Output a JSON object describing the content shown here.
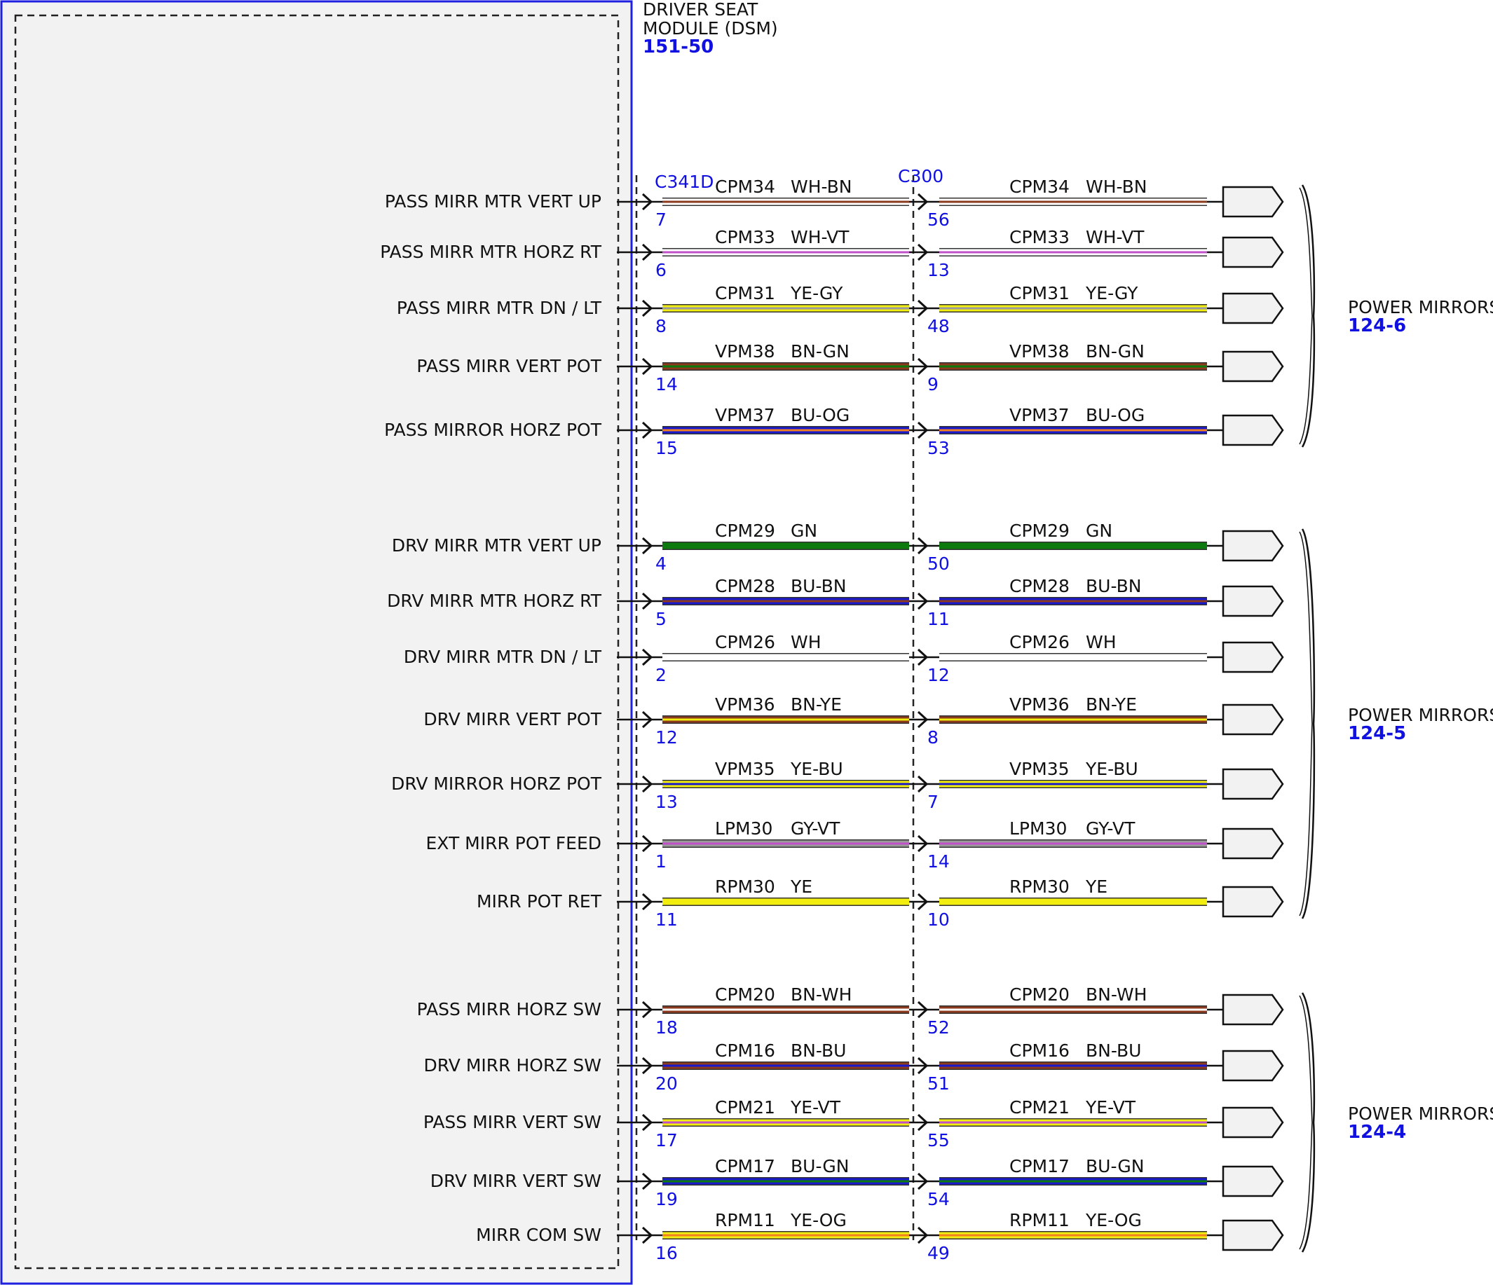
{
  "module": {
    "title_line1": "DRIVER SEAT",
    "title_line2": "MODULE (DSM)",
    "ref": "151-50"
  },
  "connectors": {
    "left": "C341D",
    "right": "C300"
  },
  "colors": {
    "WH": "#ffffff",
    "BN": "#8b3a1e",
    "VT": "#c050c8",
    "YE": "#f2ee10",
    "GY": "#9a9a9a",
    "GN": "#0c7a0c",
    "BU": "#1818cc",
    "OG": "#f08020",
    "module_border": "#2020e0",
    "module_fill": "#f2f2f2",
    "pin_text": "#1010e0"
  },
  "circuits": [
    {
      "label": "PASS MIRR MTR VERT UP",
      "circuit": "CPM34",
      "color": "WH-BN",
      "pin_a": "7",
      "pin_b": "56"
    },
    {
      "label": "PASS MIRR MTR HORZ RT",
      "circuit": "CPM33",
      "color": "WH-VT",
      "pin_a": "6",
      "pin_b": "13"
    },
    {
      "label": "PASS MIRR MTR DN / LT",
      "circuit": "CPM31",
      "color": "YE-GY",
      "pin_a": "8",
      "pin_b": "48"
    },
    {
      "label": "PASS MIRR VERT POT",
      "circuit": "VPM38",
      "color": "BN-GN",
      "pin_a": "14",
      "pin_b": "9"
    },
    {
      "label": "PASS MIRROR HORZ POT",
      "circuit": "VPM37",
      "color": "BU-OG",
      "pin_a": "15",
      "pin_b": "53"
    },
    {
      "label": "DRV MIRR MTR VERT UP",
      "circuit": "CPM29",
      "color": "GN",
      "pin_a": "4",
      "pin_b": "50"
    },
    {
      "label": "DRV MIRR MTR HORZ RT",
      "circuit": "CPM28",
      "color": "BU-BN",
      "pin_a": "5",
      "pin_b": "11"
    },
    {
      "label": "DRV MIRR MTR DN / LT",
      "circuit": "CPM26",
      "color": "WH",
      "pin_a": "2",
      "pin_b": "12"
    },
    {
      "label": "DRV MIRR VERT POT",
      "circuit": "VPM36",
      "color": "BN-YE",
      "pin_a": "12",
      "pin_b": "8"
    },
    {
      "label": "DRV MIRROR HORZ POT",
      "circuit": "VPM35",
      "color": "YE-BU",
      "pin_a": "13",
      "pin_b": "7"
    },
    {
      "label": "EXT MIRR POT FEED",
      "circuit": "LPM30",
      "color": "GY-VT",
      "pin_a": "1",
      "pin_b": "14"
    },
    {
      "label": "MIRR POT RET",
      "circuit": "RPM30",
      "color": "YE",
      "pin_a": "11",
      "pin_b": "10"
    },
    {
      "label": "PASS MIRR HORZ SW",
      "circuit": "CPM20",
      "color": "BN-WH",
      "pin_a": "18",
      "pin_b": "52"
    },
    {
      "label": "DRV MIRR HORZ SW",
      "circuit": "CPM16",
      "color": "BN-BU",
      "pin_a": "20",
      "pin_b": "51"
    },
    {
      "label": "PASS MIRR VERT SW",
      "circuit": "CPM21",
      "color": "YE-VT",
      "pin_a": "17",
      "pin_b": "55"
    },
    {
      "label": "DRV MIRR VERT SW",
      "circuit": "CPM17",
      "color": "BU-GN",
      "pin_a": "19",
      "pin_b": "54"
    },
    {
      "label": "MIRR COM SW",
      "circuit": "RPM11",
      "color": "YE-OG",
      "pin_a": "16",
      "pin_b": "49"
    }
  ],
  "destinations": [
    {
      "name": "POWER MIRRORS",
      "ref": "124-6"
    },
    {
      "name": "POWER MIRRORS",
      "ref": "124-5"
    },
    {
      "name": "POWER MIRRORS",
      "ref": "124-4"
    }
  ]
}
